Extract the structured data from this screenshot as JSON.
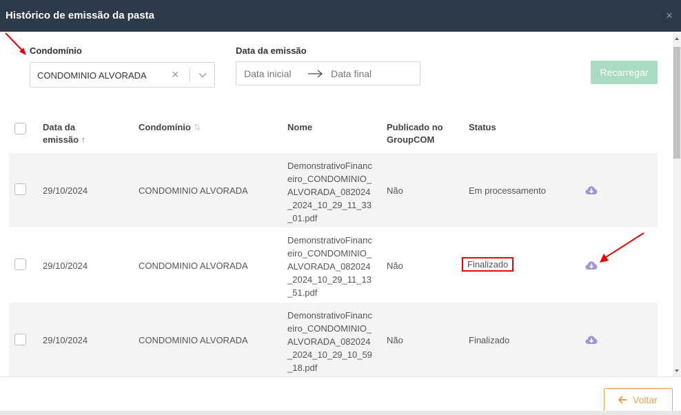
{
  "header": {
    "title": "Histórico de emissão da pasta",
    "close_icon": "×"
  },
  "filters": {
    "condominio_label": "Condomínio",
    "condominio_value": "CONDOMINIO ALVORADA",
    "clear_glyph": "×",
    "date_label": "Data da emissão",
    "date_start_placeholder": "Data inicial",
    "date_end_placeholder": "Data final",
    "reload_label": "Recarregar"
  },
  "table": {
    "columns": {
      "date_line1": "Data da",
      "date_line2": "emissão",
      "date_sort_icon": "↑",
      "condominio": "Condomínio",
      "condominio_sort_icon": "⇅",
      "name": "Nome",
      "published_line1": "Publicado no",
      "published_line2": "GroupCOM",
      "status": "Status"
    },
    "rows": [
      {
        "date": "29/10/2024",
        "condominio": "CONDOMINIO ALVORADA",
        "name": "DemonstrativoFinanceiro_CONDOMINIO_ALVORADA_082024_2024_10_29_11_33_01.pdf",
        "published": "Não",
        "status": "Em processamento"
      },
      {
        "date": "29/10/2024",
        "condominio": "CONDOMINIO ALVORADA",
        "name": "DemonstrativoFinanceiro_CONDOMINIO_ALVORADA_082024_2024_10_29_11_13_51.pdf",
        "published": "Não",
        "status": "Finalizado"
      },
      {
        "date": "29/10/2024",
        "condominio": "CONDOMINIO ALVORADA",
        "name": "DemonstrativoFinanceiro_CONDOMINIO_ALVORADA_082024_2024_10_29_10_59_18.pdf",
        "published": "Não",
        "status": "Finalizado"
      }
    ]
  },
  "footer": {
    "back_label": "Voltar"
  },
  "colors": {
    "header_bg": "#2c3a4a",
    "reload_button": "#a9dbc0",
    "back_button": "#f0a04b",
    "download_icon": "#a695d6",
    "annotation": "#e00000"
  }
}
